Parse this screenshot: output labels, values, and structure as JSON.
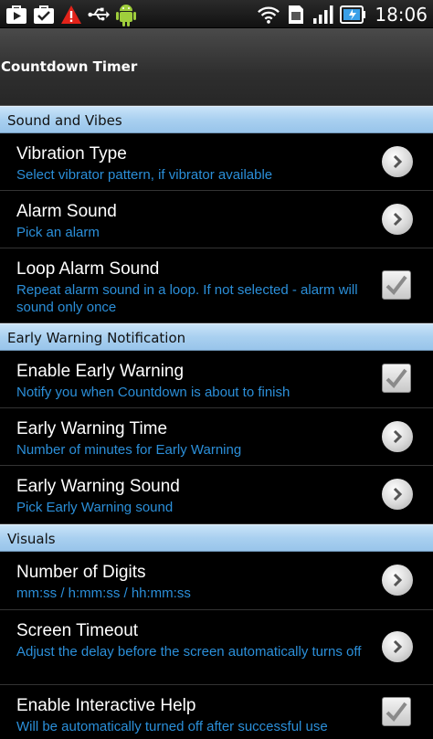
{
  "status_bar": {
    "time": "18:06",
    "left_icons": [
      "play-store-icon",
      "task-icon",
      "warning-icon",
      "usb-icon",
      "android-icon"
    ],
    "right_icons": [
      "wifi-icon",
      "sim-icon",
      "signal-icon",
      "battery-icon"
    ]
  },
  "app": {
    "title": "Countdown Timer"
  },
  "sections": [
    {
      "header": "Sound and Vibes",
      "items": [
        {
          "title": "Vibration Type",
          "summary": "Select vibrator pattern, if vibrator available",
          "widget": "chevron"
        },
        {
          "title": "Alarm Sound",
          "summary": "Pick an alarm",
          "widget": "chevron"
        },
        {
          "title": "Loop Alarm Sound",
          "summary": "Repeat alarm sound in a loop. If not selected - alarm will sound only once",
          "widget": "checkbox",
          "checked": true
        }
      ]
    },
    {
      "header": "Early Warning Notification",
      "items": [
        {
          "title": "Enable Early Warning",
          "summary": "Notify you when Countdown is about to finish",
          "widget": "checkbox",
          "checked": true
        },
        {
          "title": "Early Warning Time",
          "summary": "Number of minutes for Early Warning",
          "widget": "chevron"
        },
        {
          "title": "Early Warning Sound",
          "summary": "Pick Early Warning sound",
          "widget": "chevron"
        }
      ]
    },
    {
      "header": "Visuals",
      "items": [
        {
          "title": "Number of Digits",
          "summary": "mm:ss / h:mm:ss / hh:mm:ss",
          "widget": "chevron"
        },
        {
          "title": "Screen Timeout",
          "summary": "Adjust the delay before the screen automatically turns off",
          "widget": "chevron"
        },
        {
          "title": "Enable Interactive Help",
          "summary": "Will be automatically turned off after successful use",
          "widget": "checkbox",
          "checked": true
        }
      ]
    }
  ],
  "colors": {
    "section_bg": "#a9d0f0",
    "summary_text": "#2b8fd9",
    "background": "#000000"
  }
}
